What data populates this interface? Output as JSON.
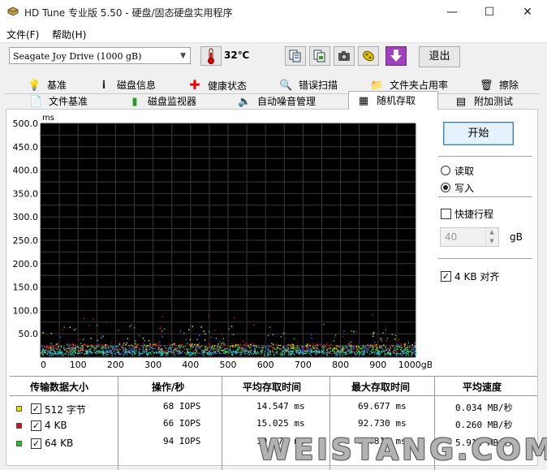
{
  "window": {
    "title": "HD Tune 专业版 5.50 - 硬盘/固态硬盘实用程序",
    "min": "—",
    "max": "☐",
    "close": "✕"
  },
  "menu": {
    "file": "文件(F)",
    "help": "帮助(H)"
  },
  "toolbar": {
    "drive": "Seagate Joy Drive (1000 gB)",
    "temperature": "32℃",
    "exit": "退出",
    "icons": [
      "copy-info-icon",
      "copy-screen-icon",
      "camera-icon",
      "options-icon",
      "download-icon"
    ]
  },
  "tabs": {
    "row1": [
      {
        "label": "基准",
        "icon": "benchmark-icon"
      },
      {
        "label": "磁盘信息",
        "icon": "info-icon"
      },
      {
        "label": "健康状态",
        "icon": "health-icon"
      },
      {
        "label": "错误扫描",
        "icon": "scan-icon"
      },
      {
        "label": "文件夹占用率",
        "icon": "folder-icon"
      },
      {
        "label": "擦除",
        "icon": "erase-icon"
      }
    ],
    "row2": [
      {
        "label": "文件基准",
        "icon": "file-benchmark-icon"
      },
      {
        "label": "磁盘监视器",
        "icon": "monitor-icon"
      },
      {
        "label": "自动噪音管理",
        "icon": "speaker-icon"
      },
      {
        "label": "随机存取",
        "icon": "random-access-icon",
        "active": true
      },
      {
        "label": "附加测试",
        "icon": "extra-tests-icon"
      }
    ]
  },
  "controls": {
    "start": "开始",
    "read": "读取",
    "write": "写入",
    "mode_selected": "write",
    "short_stroke": "快捷行程",
    "short_stroke_checked": false,
    "short_stroke_value": "40",
    "short_stroke_unit": "gB",
    "align": "4 KB 对齐",
    "align_checked": true
  },
  "chart_data": {
    "type": "scatter",
    "ylabel": "ms",
    "ylim": [
      0,
      500
    ],
    "xlim": [
      0,
      1000
    ],
    "y_ticks": [
      "500.0",
      "450.0",
      "400.0",
      "350.0",
      "300.0",
      "250.0",
      "200.0",
      "150.0",
      "100.0",
      "50.0"
    ],
    "x_ticks": [
      "0",
      "100",
      "200",
      "300",
      "400",
      "500",
      "600",
      "700",
      "800",
      "900",
      "1000gB"
    ],
    "background": "#000000",
    "grid": true,
    "series": [
      {
        "name": "512 字节",
        "color": "#e8e000",
        "typical_range_ms": [
          10,
          30
        ],
        "mean_ms": 14.547,
        "max_ms": 69.677
      },
      {
        "name": "4 KB",
        "color": "#d01010",
        "typical_range_ms": [
          10,
          30
        ],
        "mean_ms": 15.025,
        "max_ms": 92.73
      },
      {
        "name": "64 KB",
        "color": "#20c020",
        "typical_range_ms": [
          8,
          25
        ],
        "mean_ms": 10.571,
        "max_ms": 71.815
      },
      {
        "name": "",
        "color": "#3060ff",
        "typical_range_ms": [
          8,
          25
        ]
      },
      {
        "name": "",
        "color": "#20d0d0",
        "typical_range_ms": [
          5,
          15
        ]
      }
    ]
  },
  "table": {
    "headers": [
      "传输数据大小",
      "操作/秒",
      "平均存取时间",
      "最大存取时间",
      "平均速度"
    ],
    "rows": [
      {
        "label": "512 字节",
        "color": "#e8e000",
        "checked": true,
        "ops": "68 IOPS",
        "avg": "14.547 ms",
        "max": "69.677 ms",
        "speed": "0.034 MB/秒"
      },
      {
        "label": "4 KB",
        "color": "#d01010",
        "checked": true,
        "ops": "66 IOPS",
        "avg": "15.025 ms",
        "max": "92.730 ms",
        "speed": "0.260 MB/秒"
      },
      {
        "label": "64 KB",
        "color": "#20c020",
        "checked": true,
        "ops": "94 IOPS",
        "avg": "10.571 ms",
        "max": "71.815 ms",
        "speed": "5.912 MB/秒"
      }
    ]
  },
  "watermark": "WEISTANG.COM"
}
